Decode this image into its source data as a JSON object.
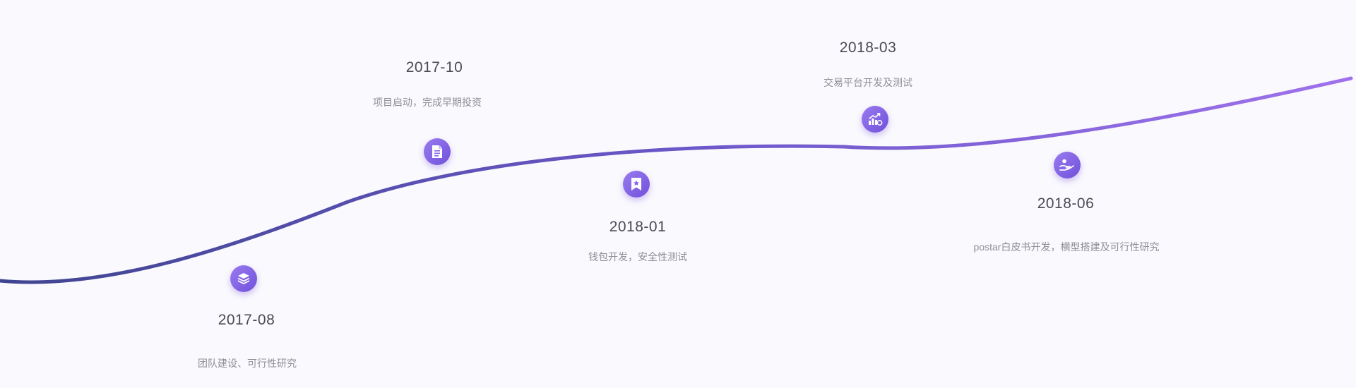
{
  "milestones": [
    {
      "date": "2017-08",
      "desc": "团队建设、可行性研究",
      "icon": "layers-icon"
    },
    {
      "date": "2017-10",
      "desc": "项目启动，完成早期投资",
      "icon": "document-icon"
    },
    {
      "date": "2018-01",
      "desc": "钱包开发，安全性测试",
      "icon": "bookmark-star-icon"
    },
    {
      "date": "2018-03",
      "desc": "交易平台开发及测试",
      "icon": "chart-growth-icon"
    },
    {
      "date": "2018-06",
      "desc": "postar白皮书开发，横型搭建及可行性研究",
      "icon": "hand-coin-icon"
    }
  ],
  "colors": {
    "background": "#faf9fe",
    "curve_start": "#3f4590",
    "curve_mid": "#6b57c8",
    "curve_end": "#9f72ec",
    "icon_fill": "#8563e6",
    "date_text": "#4a4a55",
    "desc_text": "#8e8e97"
  }
}
